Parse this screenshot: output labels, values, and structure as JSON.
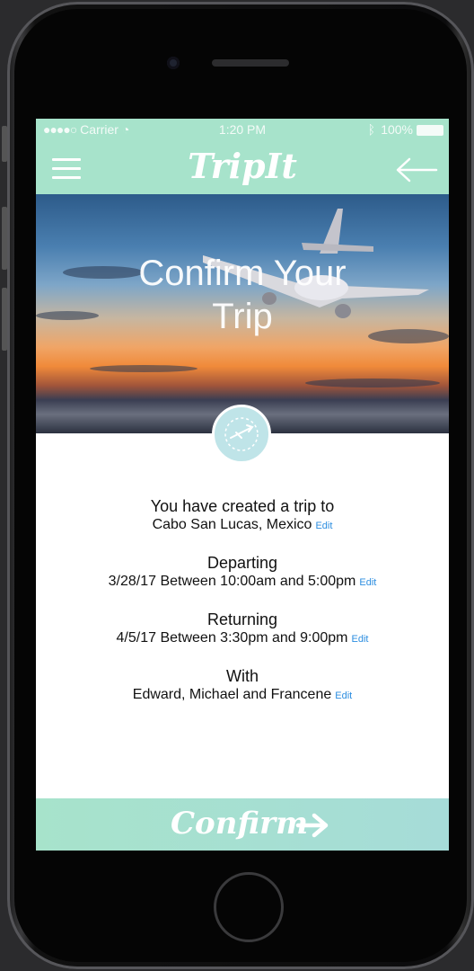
{
  "status_bar": {
    "carrier": "Carrier",
    "time": "1:20 PM",
    "battery": "100%"
  },
  "header": {
    "logo": "TripIt",
    "menu_icon": "hamburger-menu-icon",
    "back_icon": "back-arrow-icon"
  },
  "hero": {
    "title_line1": "Confirm Your",
    "title_line2": "Trip"
  },
  "summary": {
    "created_heading": "You have created a trip to",
    "destination": "Cabo San Lucas, Mexico",
    "departing_heading": "Departing",
    "departing": "3/28/17 Between 10:00am and 5:00pm",
    "returning_heading": "Returning",
    "returning": "4/5/17 Between 3:30pm and 9:00pm",
    "with_heading": "With",
    "companions": "Edward, Michael and Francene",
    "edit_label": "Edit"
  },
  "confirm": {
    "label": "Confirm"
  },
  "colors": {
    "accent": "#a7e3cb",
    "link": "#2b8de0"
  }
}
